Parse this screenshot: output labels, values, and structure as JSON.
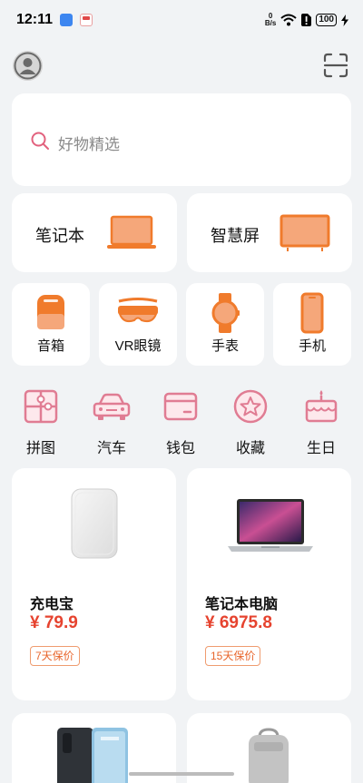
{
  "status_bar": {
    "time": "12:11",
    "net_speed_value": "0",
    "net_speed_unit": "B/s",
    "battery": "100"
  },
  "header": {
    "avatar_icon": "person-icon",
    "scan_icon": "scan-icon"
  },
  "search": {
    "placeholder": "好物精选",
    "icon": "search-icon"
  },
  "featured_categories": [
    {
      "label": "笔记本",
      "icon": "laptop-icon"
    },
    {
      "label": "智慧屏",
      "icon": "tv-icon"
    }
  ],
  "device_categories": [
    {
      "label": "音箱",
      "icon": "speaker-icon"
    },
    {
      "label": "VR眼镜",
      "icon": "vr-glasses-icon"
    },
    {
      "label": "手表",
      "icon": "watch-icon"
    },
    {
      "label": "手机",
      "icon": "phone-icon"
    }
  ],
  "quick_links": [
    {
      "label": "拼图",
      "icon": "puzzle-icon"
    },
    {
      "label": "汽车",
      "icon": "car-icon"
    },
    {
      "label": "钱包",
      "icon": "wallet-icon"
    },
    {
      "label": "收藏",
      "icon": "star-icon"
    },
    {
      "label": "生日",
      "icon": "cake-icon"
    }
  ],
  "products": [
    {
      "name": "充电宝",
      "price": "¥ 79.9",
      "tag": "7天保价",
      "image": "power-bank"
    },
    {
      "name": "笔记本电脑",
      "price": "¥ 6975.8",
      "tag": "15天保价",
      "image": "laptop"
    }
  ],
  "peek_products": [
    {
      "image": "smartphone"
    },
    {
      "image": "backpack"
    }
  ],
  "colors": {
    "accent_orange": "#f07b2c",
    "orange_fill": "#f5a77a",
    "pink_icon": "#e07c93",
    "price_red": "#e6432f",
    "background": "#f1f3f5"
  }
}
